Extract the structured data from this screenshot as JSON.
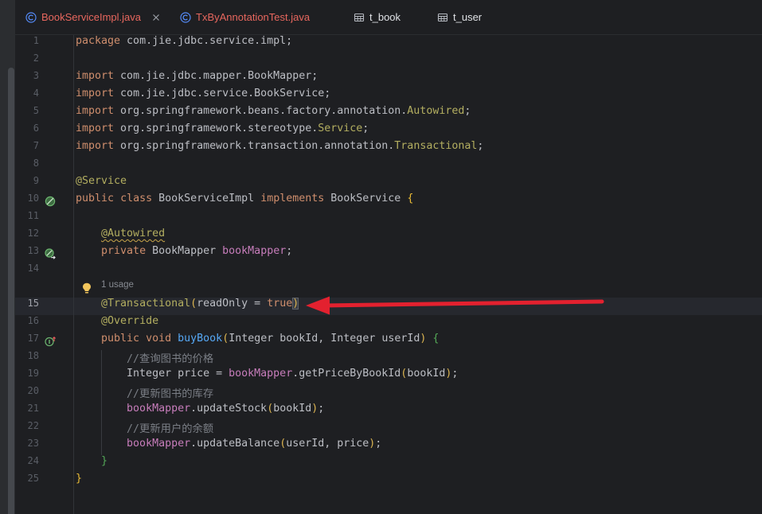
{
  "tabs": [
    {
      "label": "BookServiceImpl.java",
      "icon": "java-class-icon",
      "color": "#e8675e",
      "active": true,
      "closable": true
    },
    {
      "label": "TxByAnnotationTest.java",
      "icon": "java-class-icon",
      "color": "#e8675e",
      "active": false,
      "closable": false
    },
    {
      "label": "t_book",
      "icon": "database-table-icon",
      "color": "#dfe1e5",
      "active": false,
      "closable": false
    },
    {
      "label": "t_user",
      "icon": "database-table-icon",
      "color": "#dfe1e5",
      "active": false,
      "closable": false
    }
  ],
  "close_icon": "close-icon",
  "editor": {
    "current_line": "15",
    "lines": [
      {
        "number": "1",
        "tokens": [
          {
            "text": "package",
            "color": "#cf8e6d"
          },
          {
            "text": " com.jie.jdbc.service.impl;",
            "color": "#bcbec4"
          }
        ]
      },
      {
        "number": "2",
        "tokens": []
      },
      {
        "number": "3",
        "tokens": [
          {
            "text": "import",
            "color": "#cf8e6d"
          },
          {
            "text": " com.jie.jdbc.mapper.BookMapper;",
            "color": "#bcbec4"
          }
        ]
      },
      {
        "number": "4",
        "tokens": [
          {
            "text": "import",
            "color": "#cf8e6d"
          },
          {
            "text": " com.jie.jdbc.service.BookService;",
            "color": "#bcbec4"
          }
        ]
      },
      {
        "number": "5",
        "tokens": [
          {
            "text": "import",
            "color": "#cf8e6d"
          },
          {
            "text": " org.springframework.beans.factory.annotation.",
            "color": "#bcbec4"
          },
          {
            "text": "Autowired",
            "color": "#b3ae60"
          },
          {
            "text": ";",
            "color": "#bcbec4"
          }
        ]
      },
      {
        "number": "6",
        "tokens": [
          {
            "text": "import",
            "color": "#cf8e6d"
          },
          {
            "text": " org.springframework.stereotype.",
            "color": "#bcbec4"
          },
          {
            "text": "Service",
            "color": "#b3ae60"
          },
          {
            "text": ";",
            "color": "#bcbec4"
          }
        ]
      },
      {
        "number": "7",
        "tokens": [
          {
            "text": "import",
            "color": "#cf8e6d"
          },
          {
            "text": " org.springframework.transaction.annotation.",
            "color": "#bcbec4"
          },
          {
            "text": "Transactional",
            "color": "#b3ae60"
          },
          {
            "text": ";",
            "color": "#bcbec4"
          }
        ]
      },
      {
        "number": "8",
        "tokens": []
      },
      {
        "number": "9",
        "tokens": [
          {
            "text": "@Service",
            "color": "#b3ae60"
          }
        ]
      },
      {
        "number": "10",
        "gutter_icon": "spring-bean-icon",
        "tokens": [
          {
            "text": "public",
            "color": "#cf8e6d"
          },
          {
            "text": " ",
            "color": "#bcbec4"
          },
          {
            "text": "class",
            "color": "#cf8e6d"
          },
          {
            "text": " BookServiceImpl ",
            "color": "#bcbec4"
          },
          {
            "text": "implements",
            "color": "#cf8e6d"
          },
          {
            "text": " BookService ",
            "color": "#bcbec4"
          },
          {
            "text": "{",
            "color": "#e8ba36"
          }
        ]
      },
      {
        "number": "11",
        "tokens": []
      },
      {
        "number": "12",
        "tokens": [
          {
            "text": "    ",
            "color": "#bcbec4"
          },
          {
            "text": "@Autowired",
            "color": "#b3ae60",
            "warning": true
          }
        ]
      },
      {
        "number": "13",
        "gutter_icon": "autowired-navigation-icon",
        "tokens": [
          {
            "text": "    ",
            "color": "#bcbec4"
          },
          {
            "text": "private",
            "color": "#cf8e6d"
          },
          {
            "text": " BookMapper ",
            "color": "#bcbec4"
          },
          {
            "text": "bookMapper",
            "color": "#c77dbb"
          },
          {
            "text": ";",
            "color": "#bcbec4"
          }
        ]
      },
      {
        "number": "14",
        "tokens": []
      },
      {
        "inlay_hint": {
          "text": "1 usage",
          "icon": "lightbulb-icon"
        }
      },
      {
        "number": "15",
        "tokens": [
          {
            "text": "    ",
            "color": "#bcbec4"
          },
          {
            "text": "@Transactional",
            "color": "#b3ae60"
          },
          {
            "text": "(",
            "color": "#dcb552"
          },
          {
            "text": "readOnly = ",
            "color": "#bcbec4"
          },
          {
            "text": "true",
            "color": "#cf8e6d"
          },
          {
            "text": ")",
            "color": "#dcb552",
            "matched": true
          }
        ]
      },
      {
        "number": "16",
        "tokens": [
          {
            "text": "    ",
            "color": "#bcbec4"
          },
          {
            "text": "@Override",
            "color": "#b3ae60"
          }
        ]
      },
      {
        "number": "17",
        "gutter_icon": "implementing-method-icon",
        "tokens": [
          {
            "text": "    ",
            "color": "#bcbec4"
          },
          {
            "text": "public",
            "color": "#cf8e6d"
          },
          {
            "text": " ",
            "color": "#bcbec4"
          },
          {
            "text": "void",
            "color": "#cf8e6d"
          },
          {
            "text": " ",
            "color": "#bcbec4"
          },
          {
            "text": "buyBook",
            "color": "#56a8f5"
          },
          {
            "text": "(",
            "color": "#dcb552"
          },
          {
            "text": "Integer bookId, Integer userId",
            "color": "#bcbec4"
          },
          {
            "text": ")",
            "color": "#dcb552"
          },
          {
            "text": " ",
            "color": "#bcbec4"
          },
          {
            "text": "{",
            "color": "#54a857"
          }
        ]
      },
      {
        "number": "18",
        "tokens": [
          {
            "text": "        ",
            "color": "#bcbec4"
          },
          {
            "text": "//查询图书的价格",
            "color": "#7a7e85"
          }
        ]
      },
      {
        "number": "19",
        "tokens": [
          {
            "text": "        Integer price = ",
            "color": "#bcbec4"
          },
          {
            "text": "bookMapper",
            "color": "#c77dbb"
          },
          {
            "text": ".getPriceByBookId",
            "color": "#bcbec4"
          },
          {
            "text": "(",
            "color": "#dcb552"
          },
          {
            "text": "bookId",
            "color": "#bcbec4"
          },
          {
            "text": ")",
            "color": "#dcb552"
          },
          {
            "text": ";",
            "color": "#bcbec4"
          }
        ]
      },
      {
        "number": "20",
        "tokens": [
          {
            "text": "        ",
            "color": "#bcbec4"
          },
          {
            "text": "//更新图书的库存",
            "color": "#7a7e85"
          }
        ]
      },
      {
        "number": "21",
        "tokens": [
          {
            "text": "        ",
            "color": "#bcbec4"
          },
          {
            "text": "bookMapper",
            "color": "#c77dbb"
          },
          {
            "text": ".updateStock",
            "color": "#bcbec4"
          },
          {
            "text": "(",
            "color": "#dcb552"
          },
          {
            "text": "bookId",
            "color": "#bcbec4"
          },
          {
            "text": ")",
            "color": "#dcb552"
          },
          {
            "text": ";",
            "color": "#bcbec4"
          }
        ]
      },
      {
        "number": "22",
        "tokens": [
          {
            "text": "        ",
            "color": "#bcbec4"
          },
          {
            "text": "//更新用户的余额",
            "color": "#7a7e85"
          }
        ]
      },
      {
        "number": "23",
        "tokens": [
          {
            "text": "        ",
            "color": "#bcbec4"
          },
          {
            "text": "bookMapper",
            "color": "#c77dbb"
          },
          {
            "text": ".updateBalance",
            "color": "#bcbec4"
          },
          {
            "text": "(",
            "color": "#dcb552"
          },
          {
            "text": "userId, price",
            "color": "#bcbec4"
          },
          {
            "text": ")",
            "color": "#dcb552"
          },
          {
            "text": ";",
            "color": "#bcbec4"
          }
        ]
      },
      {
        "number": "24",
        "tokens": [
          {
            "text": "    ",
            "color": "#bcbec4"
          },
          {
            "text": "}",
            "color": "#54a857"
          }
        ]
      },
      {
        "number": "25",
        "tokens": [
          {
            "text": "}",
            "color": "#e8ba36"
          }
        ]
      }
    ]
  }
}
